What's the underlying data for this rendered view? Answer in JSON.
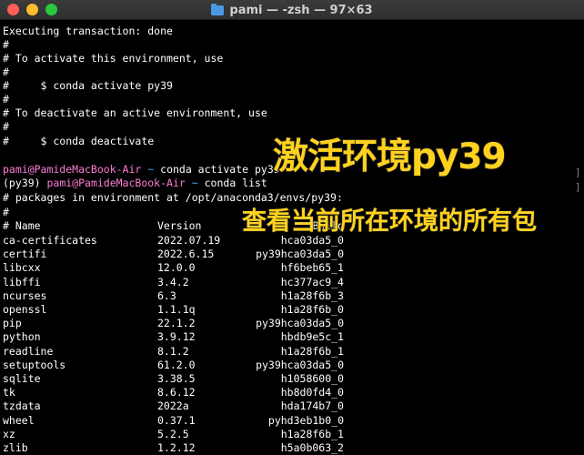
{
  "window": {
    "title": "pami — -zsh — 97×63"
  },
  "terminal": {
    "lines": [
      "Executing transaction: done",
      "#",
      "# To activate this environment, use",
      "#",
      "#     $ conda activate py39",
      "#",
      "# To deactivate an active environment, use",
      "#",
      "#     $ conda deactivate"
    ],
    "prompt1": {
      "user": "pami@PamideMacBook-Air",
      "path": "~",
      "command": "conda activate py39"
    },
    "prompt2": {
      "env": "(py39)",
      "user": "pami@PamideMacBook-Air",
      "path": "~",
      "command": "conda list"
    },
    "after_lines": [
      "# packages in environment at /opt/anaconda3/envs/py39:",
      "#"
    ],
    "table_header": {
      "name": "# Name",
      "version": "Version",
      "build": "Build"
    },
    "packages": [
      {
        "name": "ca-certificates",
        "version": "2022.07.19",
        "build": "hca03da5_0"
      },
      {
        "name": "certifi",
        "version": "2022.6.15",
        "build": "py39hca03da5_0"
      },
      {
        "name": "libcxx",
        "version": "12.0.0",
        "build": "hf6beb65_1"
      },
      {
        "name": "libffi",
        "version": "3.4.2",
        "build": "hc377ac9_4"
      },
      {
        "name": "ncurses",
        "version": "6.3",
        "build": "h1a28f6b_3"
      },
      {
        "name": "openssl",
        "version": "1.1.1q",
        "build": "h1a28f6b_0"
      },
      {
        "name": "pip",
        "version": "22.1.2",
        "build": "py39hca03da5_0"
      },
      {
        "name": "python",
        "version": "3.9.12",
        "build": "hbdb9e5c_1"
      },
      {
        "name": "readline",
        "version": "8.1.2",
        "build": "h1a28f6b_1"
      },
      {
        "name": "setuptools",
        "version": "61.2.0",
        "build": "py39hca03da5_0"
      },
      {
        "name": "sqlite",
        "version": "3.38.5",
        "build": "h1058600_0"
      },
      {
        "name": "tk",
        "version": "8.6.12",
        "build": "hb8d0fd4_0"
      },
      {
        "name": "tzdata",
        "version": "2022a",
        "build": "hda174b7_0"
      },
      {
        "name": "wheel",
        "version": "0.37.1",
        "build": "pyhd3eb1b0_0"
      },
      {
        "name": "xz",
        "version": "5.2.5",
        "build": "h1a28f6b_1"
      },
      {
        "name": "zlib",
        "version": "1.2.12",
        "build": "h5a0b063_2"
      }
    ]
  },
  "overlay": {
    "heading": "激活环境py39",
    "caption": "查看当前所在环境的所有包"
  },
  "colors": {
    "background": "#000000",
    "text": "#ffffff",
    "prompt_user": "#ff7bd6",
    "prompt_path": "#4aa3ff",
    "overlay_text": "#ffd21f"
  }
}
